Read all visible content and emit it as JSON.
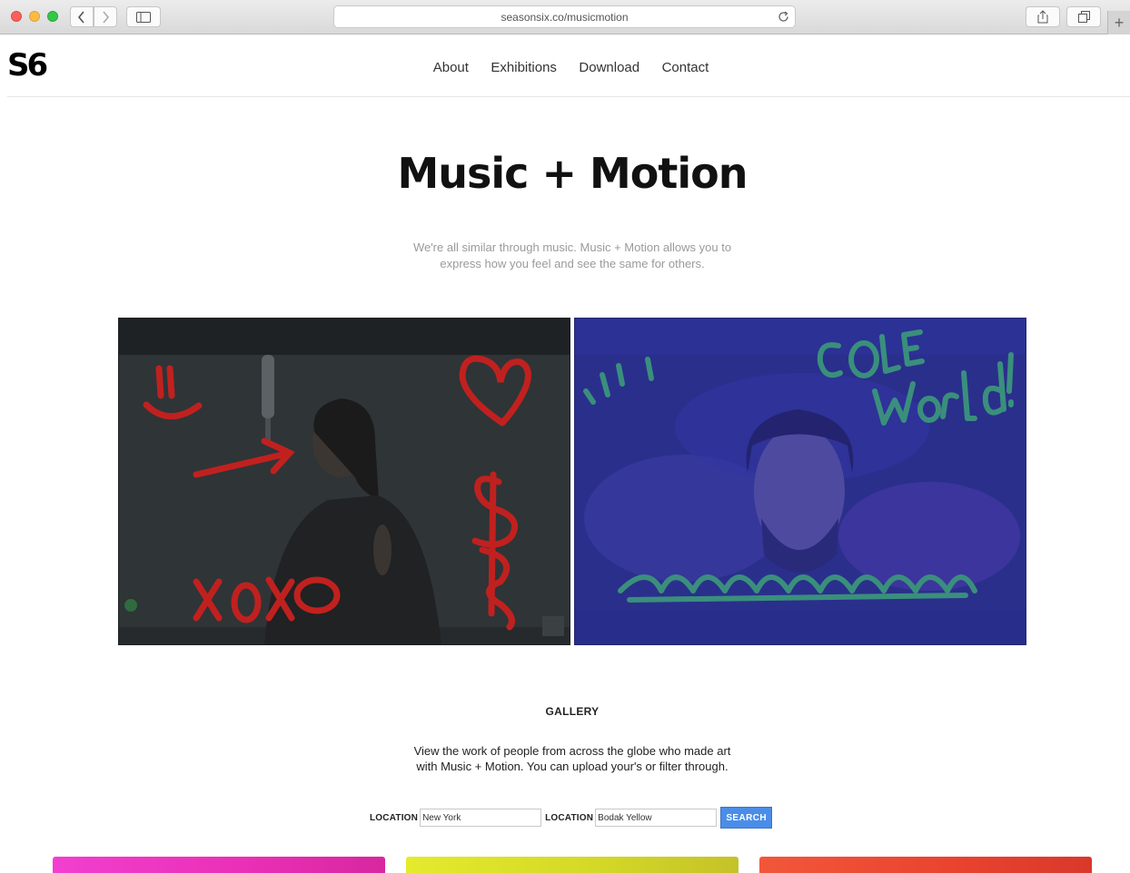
{
  "browser": {
    "url": "seasonsix.co/musicmotion",
    "new_tab": "+"
  },
  "header": {
    "logo": "S6",
    "nav": [
      "About",
      "Exhibitions",
      "Download",
      "Contact"
    ]
  },
  "hero": {
    "title": "Music + Motion",
    "subtitle_line1": "We're all similar through music. Music + Motion allows you to",
    "subtitle_line2": "express how you feel and see the same for others."
  },
  "artworks": [
    {
      "doodles": [
        "smiley",
        "heart",
        "arrow",
        "dollar-sign",
        "XOXO"
      ],
      "accent": "#c0211f"
    },
    {
      "doodles": [
        "COLE",
        "World!",
        "wave"
      ],
      "accent": "#3a8f7c"
    }
  ],
  "gallery": {
    "heading": "GALLERY",
    "text_line1": "View the work of people from across the globe who made art",
    "text_line2": "with Music + Motion. You can upload your's or filter through.",
    "filter1_label": "LOCATION",
    "filter1_value": "New York",
    "filter2_label": "LOCATION",
    "filter2_value": "Bodak Yellow",
    "search_label": "SEARCH",
    "card_colors": [
      "#ee34c2",
      "#dde02a",
      "#ec4a31"
    ]
  }
}
